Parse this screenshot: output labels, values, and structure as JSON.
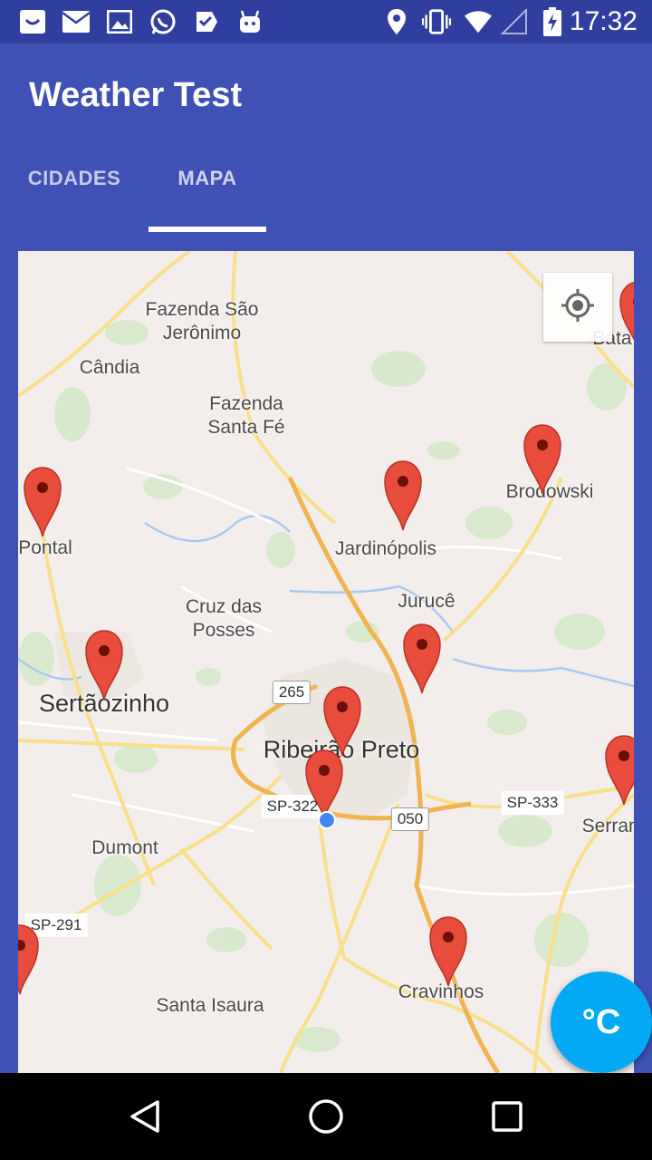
{
  "status_bar": {
    "time": "17:32",
    "left_icons": [
      "notification-icon",
      "mail-icon",
      "image-icon",
      "whatsapp-icon",
      "task-icon",
      "android-icon"
    ],
    "right_icons": [
      "location-icon",
      "vibrate-icon",
      "wifi-icon",
      "signal-icon",
      "battery-charging-icon"
    ]
  },
  "app_bar": {
    "title": "Weather Test",
    "tabs": [
      {
        "label": "CIDADES",
        "selected": false
      },
      {
        "label": "MAPA",
        "selected": true
      }
    ]
  },
  "map": {
    "places": [
      {
        "name": "Fazenda São\nJerônimo"
      },
      {
        "name": "Cândia"
      },
      {
        "name": "Fazenda\nSanta Fé"
      },
      {
        "name": "Pontal"
      },
      {
        "name": "Brodowski"
      },
      {
        "name": "Jardinópolis"
      },
      {
        "name": "Jurucê"
      },
      {
        "name": "Cruz das\nPosses"
      },
      {
        "name": "Sertãozinho"
      },
      {
        "name": "Ribeirão Preto"
      },
      {
        "name": "Dumont"
      },
      {
        "name": "Serrana"
      },
      {
        "name": "Santa Isaura"
      },
      {
        "name": "Cravinhos"
      },
      {
        "name": "Bata"
      }
    ],
    "road_shields": [
      "265",
      "050"
    ],
    "road_labels": [
      "SP-322",
      "SP-333",
      "SP-291"
    ],
    "my_location_icon": "crosshair-icon",
    "marker_color": "#e74c3c"
  },
  "fab": {
    "label": "°C",
    "color": "#03a9f4"
  },
  "nav_bar": {
    "icons": [
      "back-icon",
      "home-icon",
      "recents-icon"
    ]
  },
  "colors": {
    "primary": "#3f51b5",
    "primary_dark": "#303f9f",
    "accent": "#03a9f4"
  }
}
